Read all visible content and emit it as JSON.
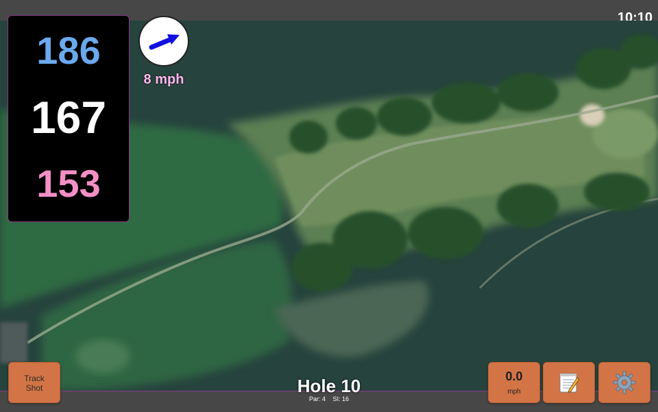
{
  "status": {
    "time": "10:10"
  },
  "distances": {
    "back": "186",
    "middle": "167",
    "front": "153"
  },
  "wind": {
    "speed": "8 mph",
    "icon": "wind-direction-arrow-icon"
  },
  "hole": {
    "title": "Hole 10",
    "par_label": "Par: 4",
    "si_label": "SI: 16"
  },
  "buttons": {
    "track_shot": "Track\nShot",
    "speed_value": "0.0",
    "speed_unit": "mph",
    "notes_icon": "notepad-icon",
    "settings_icon": "gear-icon"
  },
  "colors": {
    "back": "#6aa9ee",
    "middle": "#ffffff",
    "front": "#f48fc6",
    "button": "#d27446",
    "wind_arrow": "#1010e0",
    "accent_border": "#8a3a8a"
  }
}
